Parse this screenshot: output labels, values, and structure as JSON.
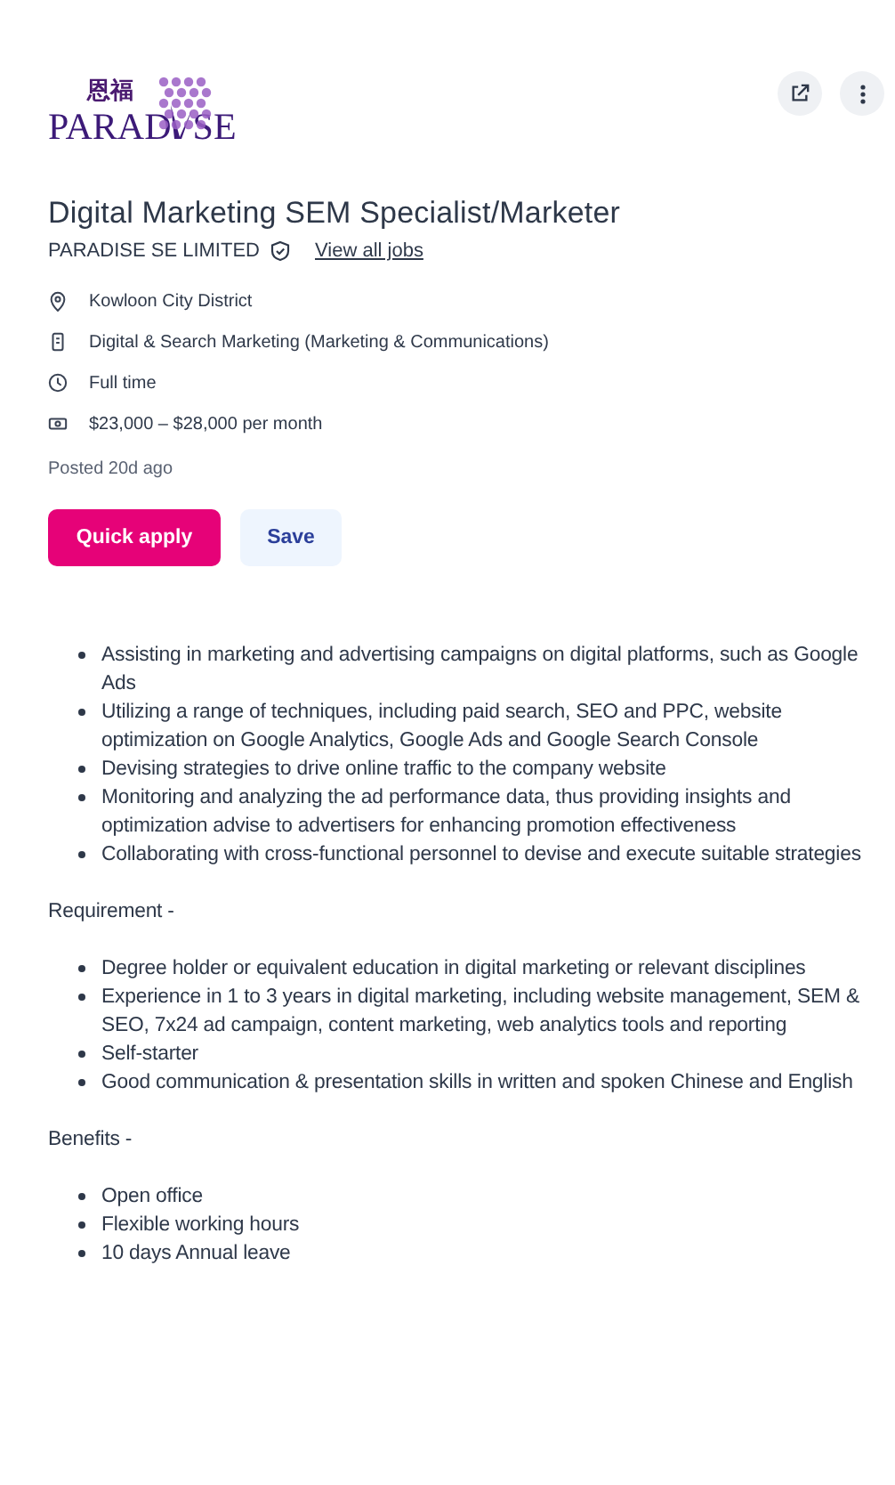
{
  "logo": {
    "chinese": "恩福",
    "name_start": "PARAD",
    "name_end": "SE"
  },
  "actions": [
    {
      "kind": "share"
    },
    {
      "kind": "more"
    }
  ],
  "title": "Digital Marketing SEM Specialist/Marketer",
  "company": {
    "name": "PARADISE SE LIMITED",
    "verified": true,
    "link": "View all jobs"
  },
  "details": [
    {
      "kind": "location",
      "text": "Kowloon City District"
    },
    {
      "kind": "category",
      "text": "Digital & Search Marketing (Marketing & Communications)"
    },
    {
      "kind": "worktype",
      "text": "Full time"
    },
    {
      "kind": "salary",
      "text": "$23,000 – $28,000 per month"
    }
  ],
  "posted": "Posted 20d ago",
  "buttons": [
    {
      "kind": "primary",
      "label": "Quick apply"
    },
    {
      "kind": "secondary",
      "label": "Save"
    }
  ],
  "description": [
    {
      "kind": "list",
      "items": [
        "Assisting in marketing and advertising campaigns on digital platforms, such as Google Ads",
        "Utilizing a range of techniques, including paid search, SEO and PPC, website optimization on Google Analytics, Google Ads and Google Search Console",
        "Devising strategies to drive online traffic to the company website",
        "Monitoring and analyzing the ad performance data, thus providing insights and optimization advise to advertisers for enhancing promotion effectiveness",
        "Collaborating with cross-functional personnel to devise and execute suitable strategies"
      ]
    },
    {
      "kind": "heading",
      "text": "Requirement -"
    },
    {
      "kind": "list",
      "items": [
        "Degree holder or equivalent education in digital marketing or relevant disciplines",
        "Experience in 1 to 3 years in digital marketing, including website management, SEM & SEO, 7x24 ad campaign, content marketing, web analytics tools and reporting",
        "Self-starter",
        "Good communication & presentation skills in written and spoken Chinese and English"
      ]
    },
    {
      "kind": "heading",
      "text": "Benefits -"
    },
    {
      "kind": "list",
      "items": [
        "Open office",
        "Flexible working hours",
        "10 days Annual leave"
      ]
    }
  ]
}
